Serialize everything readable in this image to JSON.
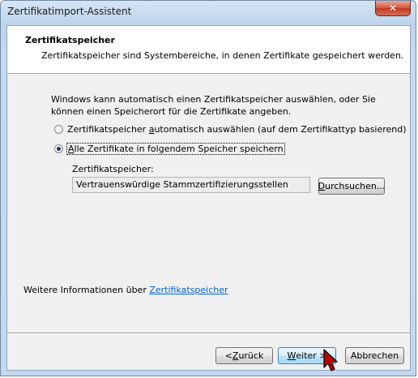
{
  "window": {
    "title": "Zertifikatimport-Assistent",
    "close_glyph": "✕"
  },
  "header": {
    "title": "Zertifikatspeicher",
    "description": "Zertifikatspeicher sind Systembereiche, in denen Zertifikate gespeichert werden."
  },
  "body": {
    "intro": "Windows kann automatisch einen Zertifikatspeicher auswählen, oder Sie können einen Speicherort für die Zertifikate angeben.",
    "options": [
      {
        "pre": "Zertifikatspeicher ",
        "mnemonic": "a",
        "post": "utomatisch auswählen (auf dem Zertifikattyp basierend)",
        "checked": false
      },
      {
        "pre": "",
        "mnemonic": "A",
        "post": "lle Zertifikate in folgendem Speicher speichern",
        "checked": true
      }
    ],
    "store_label": "Zertifikatspeicher:",
    "store_value": "Vertrauenswürdige Stammzertifizierungsstellen",
    "browse_pre": "",
    "browse_mnemonic": "D",
    "browse_post": "urchsuchen...",
    "more_info_text": "Weitere Informationen über ",
    "more_info_link": "Zertifikatspeicher"
  },
  "footer": {
    "back_pre": "< ",
    "back_mnemonic": "Z",
    "back_post": "urück",
    "next_pre": "",
    "next_mnemonic": "W",
    "next_post": "eiter >",
    "cancel_label": "Abbrechen"
  },
  "colors": {
    "accent": "#3c7fb1",
    "link": "#0066cc",
    "close_red": "#c03a21"
  }
}
